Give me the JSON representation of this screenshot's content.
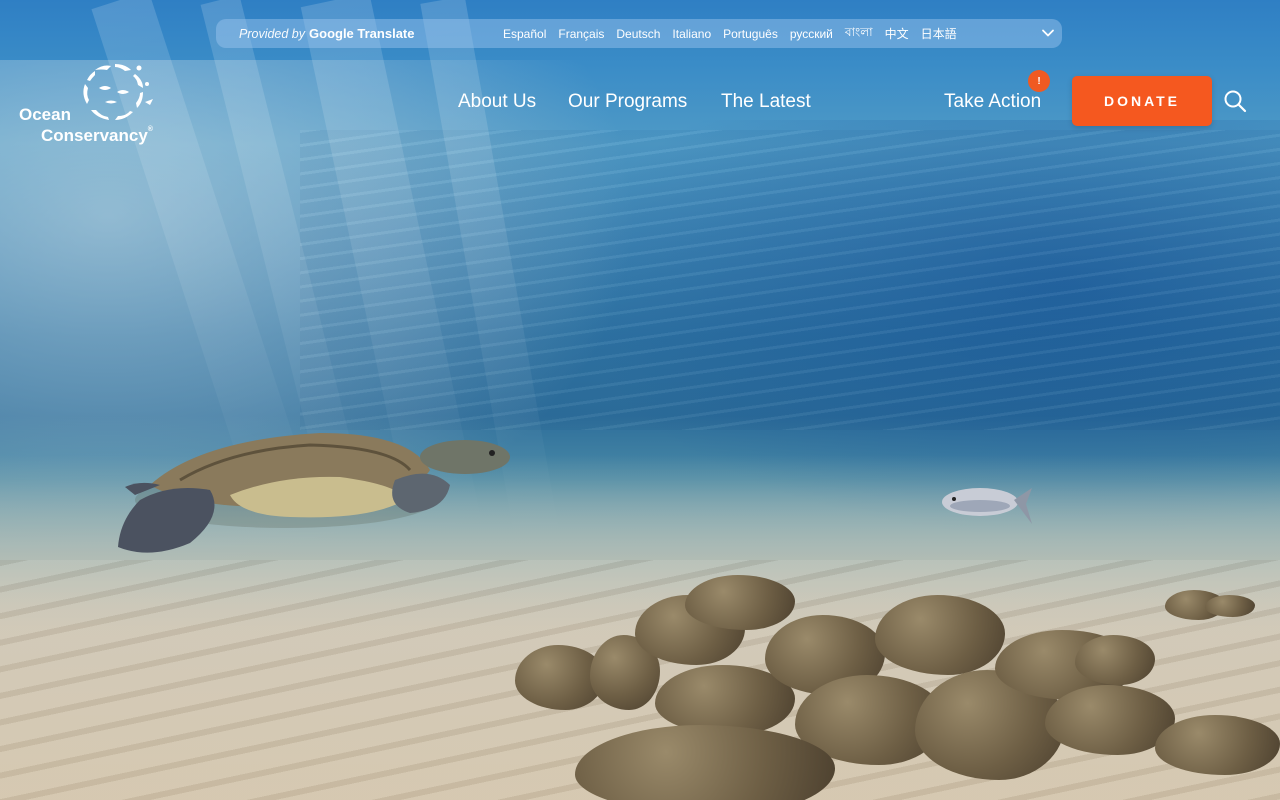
{
  "translate": {
    "provided_by": "Provided by",
    "provider": "Google Translate",
    "languages": [
      "Español",
      "Français",
      "Deutsch",
      "Italiano",
      "Português",
      "русский",
      "বাংলা",
      "中文",
      "日本語"
    ],
    "dropdown_icon": "chevron-down-icon"
  },
  "logo": {
    "line1": "Ocean",
    "line2": "Conservancy",
    "registered": "®",
    "emblem_icon": "marine-life-circle-emblem"
  },
  "nav": {
    "items": [
      "About Us",
      "Our Programs",
      "The Latest",
      "Take Action"
    ],
    "take_action_badge": "!",
    "donate_label": "DONATE",
    "search_icon": "search-icon"
  },
  "colors": {
    "accent": "#f5581f",
    "badge": "#f05a22",
    "text": "#ffffff"
  },
  "hero": {
    "image": "underwater-sea-turtle-scene"
  }
}
